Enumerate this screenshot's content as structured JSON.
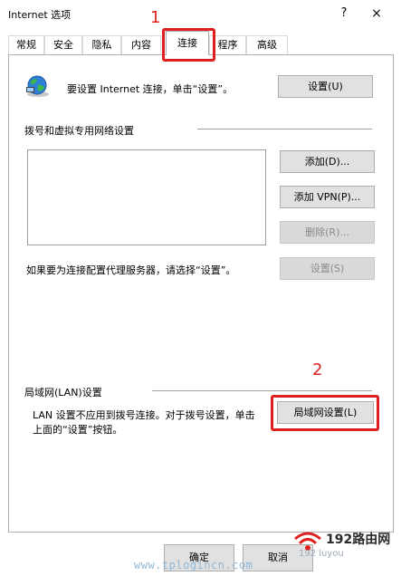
{
  "window": {
    "title": "Internet 选项",
    "help": "?",
    "close": "×"
  },
  "tabs": [
    {
      "label": "常规"
    },
    {
      "label": "安全"
    },
    {
      "label": "隐私"
    },
    {
      "label": "内容"
    },
    {
      "label": "连接"
    },
    {
      "label": "程序"
    },
    {
      "label": "高级"
    }
  ],
  "setup": {
    "text": "要设置 Internet 连接，单击“设置”。",
    "button": "设置(U)"
  },
  "dialup": {
    "header": "拨号和虚拟专用网络设置",
    "add": "添加(D)...",
    "add_vpn": "添加 VPN(P)...",
    "remove": "删除(R)...",
    "settings": "设置(S)",
    "proxy_text": "如果要为连接配置代理服务器，请选择“设置”。"
  },
  "lan": {
    "header": "局域网(LAN)设置",
    "text_line1": "LAN 设置不应用到拨号连接。对于拨号设置，单击",
    "text_line2": "上面的“设置”按钮。",
    "button": "局域网设置(L)"
  },
  "footer": {
    "ok": "确定",
    "cancel": "取消"
  },
  "annotations": {
    "num1": "1",
    "num2": "2",
    "color": "#e02020"
  },
  "watermark": {
    "url": "www.tplogincn.com",
    "logo": "192路由网",
    "logo_small": "192 luyou"
  }
}
